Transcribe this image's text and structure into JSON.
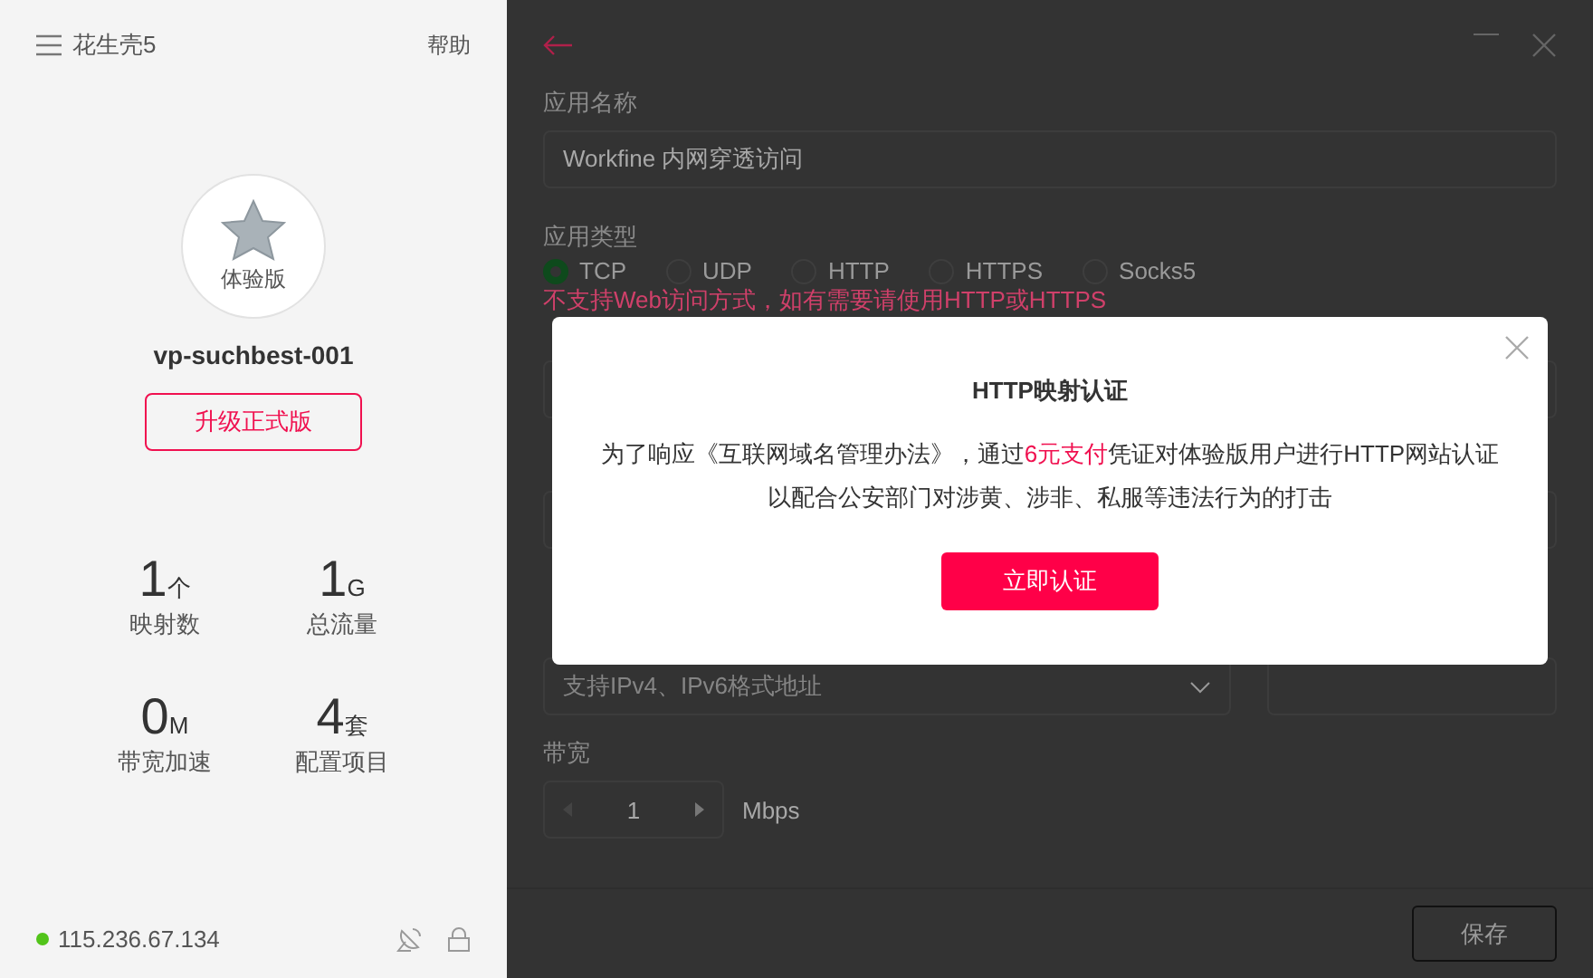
{
  "sidebar": {
    "app_title": "花生壳5",
    "help": "帮助",
    "edition_badge": "体验版",
    "account": "vp-suchbest-001",
    "upgrade_button": "升级正式版",
    "stats": [
      {
        "value": "1",
        "unit": "个",
        "label": "映射数"
      },
      {
        "value": "1",
        "unit": "G",
        "label": "总流量"
      },
      {
        "value": "0",
        "unit": "M",
        "label": "带宽加速"
      },
      {
        "value": "4",
        "unit": "套",
        "label": "配置项目"
      }
    ],
    "status": {
      "online": true,
      "ip": "115.236.67.134"
    }
  },
  "form": {
    "name_label": "应用名称",
    "name_value": "Workfine 内网穿透访问",
    "type_label": "应用类型",
    "types": [
      {
        "label": "TCP",
        "selected": true
      },
      {
        "label": "UDP",
        "selected": false
      },
      {
        "label": "HTTP",
        "selected": false
      },
      {
        "label": "HTTPS",
        "selected": false
      },
      {
        "label": "Socks5",
        "selected": false
      }
    ],
    "type_warning": "不支持Web访问方式，如有需要请使用HTTP或HTTPS",
    "host_placeholder": "支持IPv4、IPv6格式地址",
    "bandwidth_label": "带宽",
    "bandwidth_value": "1",
    "bandwidth_unit": "Mbps",
    "save_button": "保存"
  },
  "modal": {
    "title": "HTTP映射认证",
    "lines": [
      [
        {
          "text": "为了响应《互联网域名管理办法》，通过",
          "highlight": false
        },
        {
          "text": "6元支付",
          "highlight": true
        },
        {
          "text": "凭证对体验版用户进行HTTP网站认证",
          "highlight": false
        }
      ],
      [
        {
          "text": "以配合公安部门对涉黄、涉非、私服等违法行为的打击",
          "highlight": false
        }
      ]
    ],
    "confirm_button": "立即认证"
  }
}
